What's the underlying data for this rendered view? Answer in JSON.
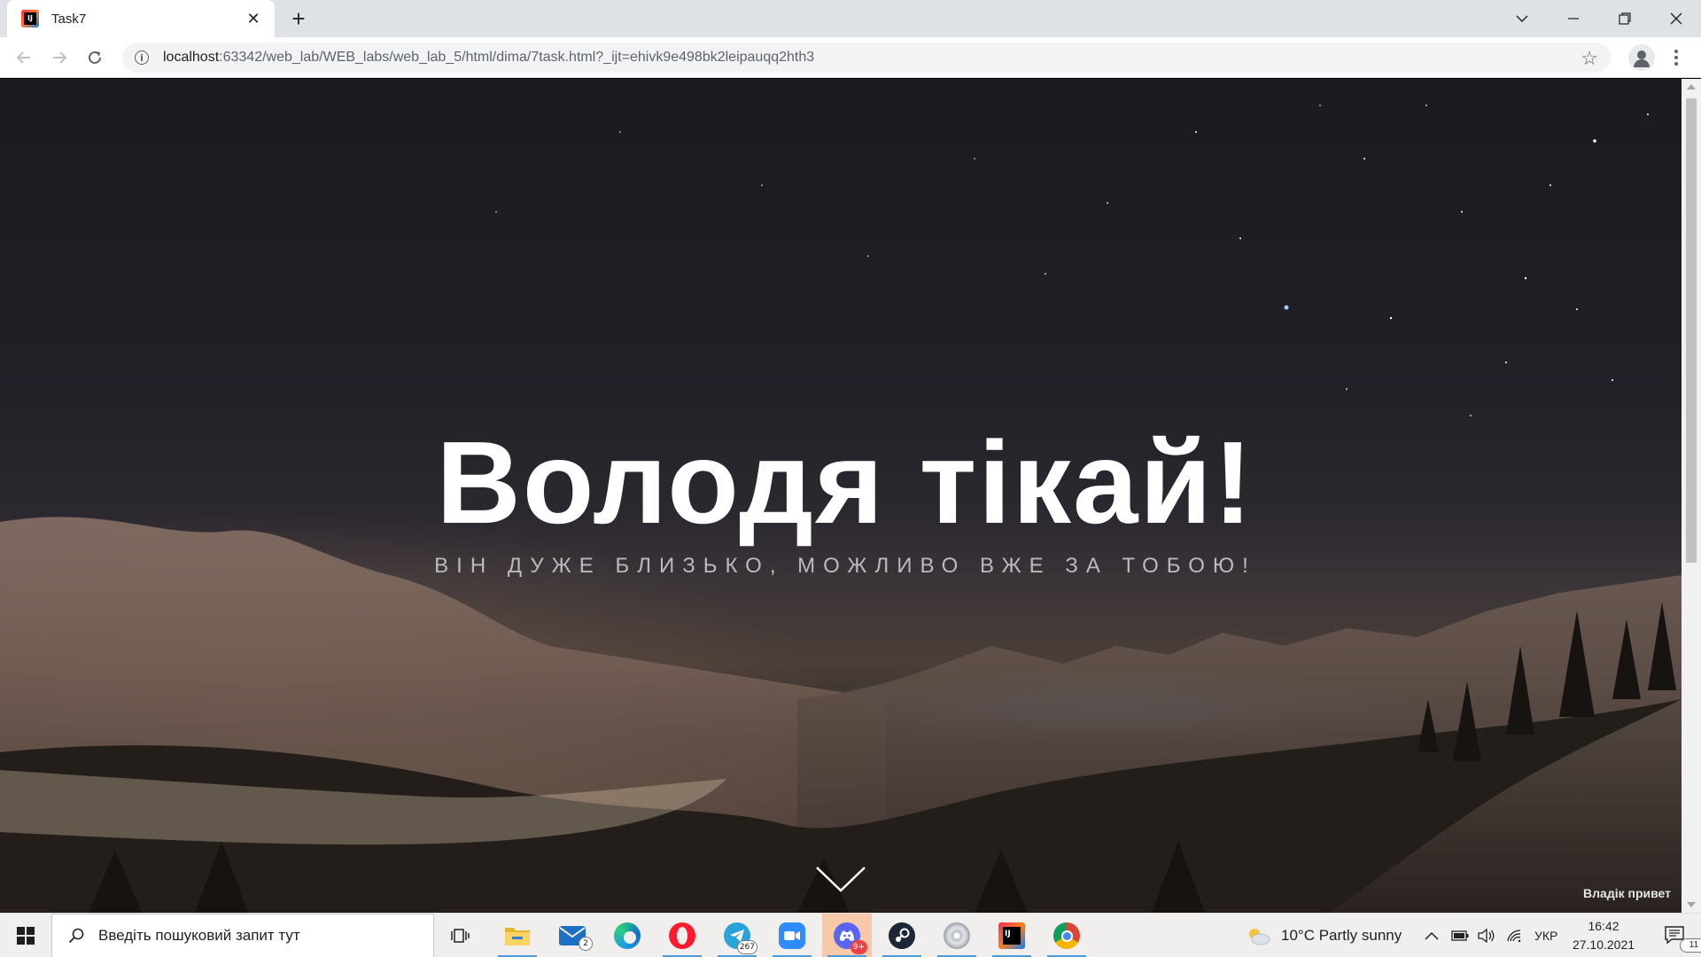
{
  "browser": {
    "tab_title": "Task7",
    "tab_close": "✕",
    "new_tab": "+",
    "url_host": "localhost",
    "url_rest": ":63342/web_lab/WEB_labs/web_lab_5/html/dima/7task.html?_ijt=ehivk9e498bk2leipauqq2hth3"
  },
  "page": {
    "title": "Володя тікай!",
    "subtitle": "ВІН ДУЖЕ БЛИЗЬКО, МОЖЛИВО ВЖЕ ЗА ТОБОЮ!",
    "corner_note": "Владік привет"
  },
  "taskbar": {
    "search_placeholder": "Введіть пошуковий запит тут",
    "apps": [
      {
        "name": "task-view",
        "icon": "task-view-icon"
      },
      {
        "name": "file-explorer",
        "icon": "folder-icon"
      },
      {
        "name": "mail",
        "icon": "mail-icon",
        "badge": "2"
      },
      {
        "name": "edge",
        "icon": "edge-icon"
      },
      {
        "name": "opera",
        "icon": "opera-icon"
      },
      {
        "name": "telegram",
        "icon": "telegram-icon",
        "badge": "267"
      },
      {
        "name": "zoom",
        "icon": "zoom-icon"
      },
      {
        "name": "discord",
        "icon": "discord-icon",
        "badge": "9+"
      },
      {
        "name": "steam",
        "icon": "steam-icon"
      },
      {
        "name": "disc",
        "icon": "disc-icon"
      },
      {
        "name": "intellij",
        "icon": "intellij-icon"
      },
      {
        "name": "chrome",
        "icon": "chrome-icon"
      }
    ],
    "weather": "10°C  Partly sunny",
    "language": "УКР",
    "time": "16:42",
    "date": "27.10.2021",
    "notification_count": "11"
  },
  "colors": {
    "accent": "#4a9ad8",
    "hero_text": "#ffffff",
    "subtitle_text": "#b9b9bf"
  }
}
